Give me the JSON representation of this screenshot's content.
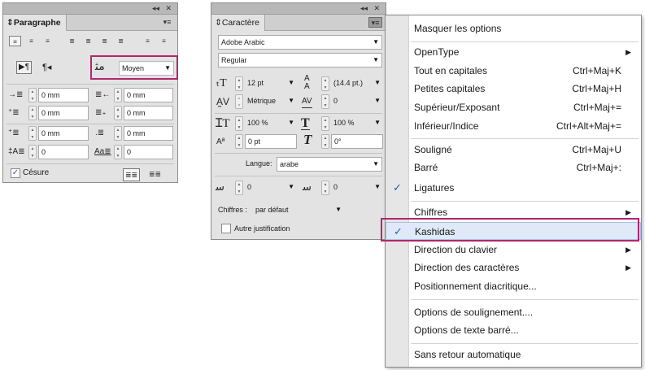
{
  "colors": {
    "highlight": "#b4256a",
    "check": "#1a5bb7",
    "panel_bg": "#e3e3e3"
  },
  "paragraphe": {
    "title": "Paragraphe",
    "menu_icon": "panel-menu-icon",
    "kashida_value": "Moyen",
    "left_indent": "0 mm",
    "right_indent": "0 mm",
    "first_indent": "0 mm",
    "last_indent": "0 mm",
    "space_before": "0 mm",
    "space_after": "0 mm",
    "drop_lines": "0",
    "drop_chars": "0",
    "hyphenation_label": "Césure",
    "hyphenation_checked": true
  },
  "caractere": {
    "title": "Caractère",
    "font_family": "Adobe Arabic",
    "font_style": "Regular",
    "size": "12 pt",
    "leading": "(14.4 pt.)",
    "kerning": "Métrique",
    "tracking": "0",
    "vscale": "100 %",
    "hscale": "100 %",
    "baseline": "0 pt",
    "skew": "0°",
    "language_label": "Langue:",
    "language": "arabe",
    "diacritic_x": "0",
    "diacritic_y": "0",
    "digits_label": "Chiffres :",
    "digits": "par défaut",
    "other_justification_label": "Autre justification"
  },
  "menu": {
    "items": [
      {
        "label": "Masquer les options",
        "shortcut": "",
        "checked": false,
        "submenu": false
      },
      {
        "label": "OpenType",
        "shortcut": "",
        "checked": false,
        "submenu": true
      },
      {
        "label": "Tout en capitales",
        "shortcut": "Ctrl+Maj+K",
        "checked": false,
        "submenu": false
      },
      {
        "label": "Petites capitales",
        "shortcut": "Ctrl+Maj+H",
        "checked": false,
        "submenu": false
      },
      {
        "label": "Supérieur/Exposant",
        "shortcut": "Ctrl+Maj+=",
        "checked": false,
        "submenu": false
      },
      {
        "label": "Inférieur/Indice",
        "shortcut": "Ctrl+Alt+Maj+=",
        "checked": false,
        "submenu": false
      },
      {
        "label": "Souligné",
        "shortcut": "Ctrl+Maj+U",
        "checked": false,
        "submenu": false
      },
      {
        "label": "Barré",
        "shortcut": "Ctrl+Maj+:",
        "checked": false,
        "submenu": false
      },
      {
        "label": "Ligatures",
        "shortcut": "",
        "checked": true,
        "submenu": false
      },
      {
        "label": "Chiffres",
        "shortcut": "",
        "checked": false,
        "submenu": true
      },
      {
        "label": "Kashidas",
        "shortcut": "",
        "checked": true,
        "submenu": false
      },
      {
        "label": "Direction du clavier",
        "shortcut": "",
        "checked": false,
        "submenu": true
      },
      {
        "label": "Direction des caractères",
        "shortcut": "",
        "checked": false,
        "submenu": true
      },
      {
        "label": "Positionnement diacritique...",
        "shortcut": "",
        "checked": false,
        "submenu": false
      },
      {
        "label": "Options de soulignement....",
        "shortcut": "",
        "checked": false,
        "submenu": false
      },
      {
        "label": "Options de texte barré...",
        "shortcut": "",
        "checked": false,
        "submenu": false
      },
      {
        "label": "Sans retour automatique",
        "shortcut": "",
        "checked": false,
        "submenu": false
      }
    ]
  }
}
